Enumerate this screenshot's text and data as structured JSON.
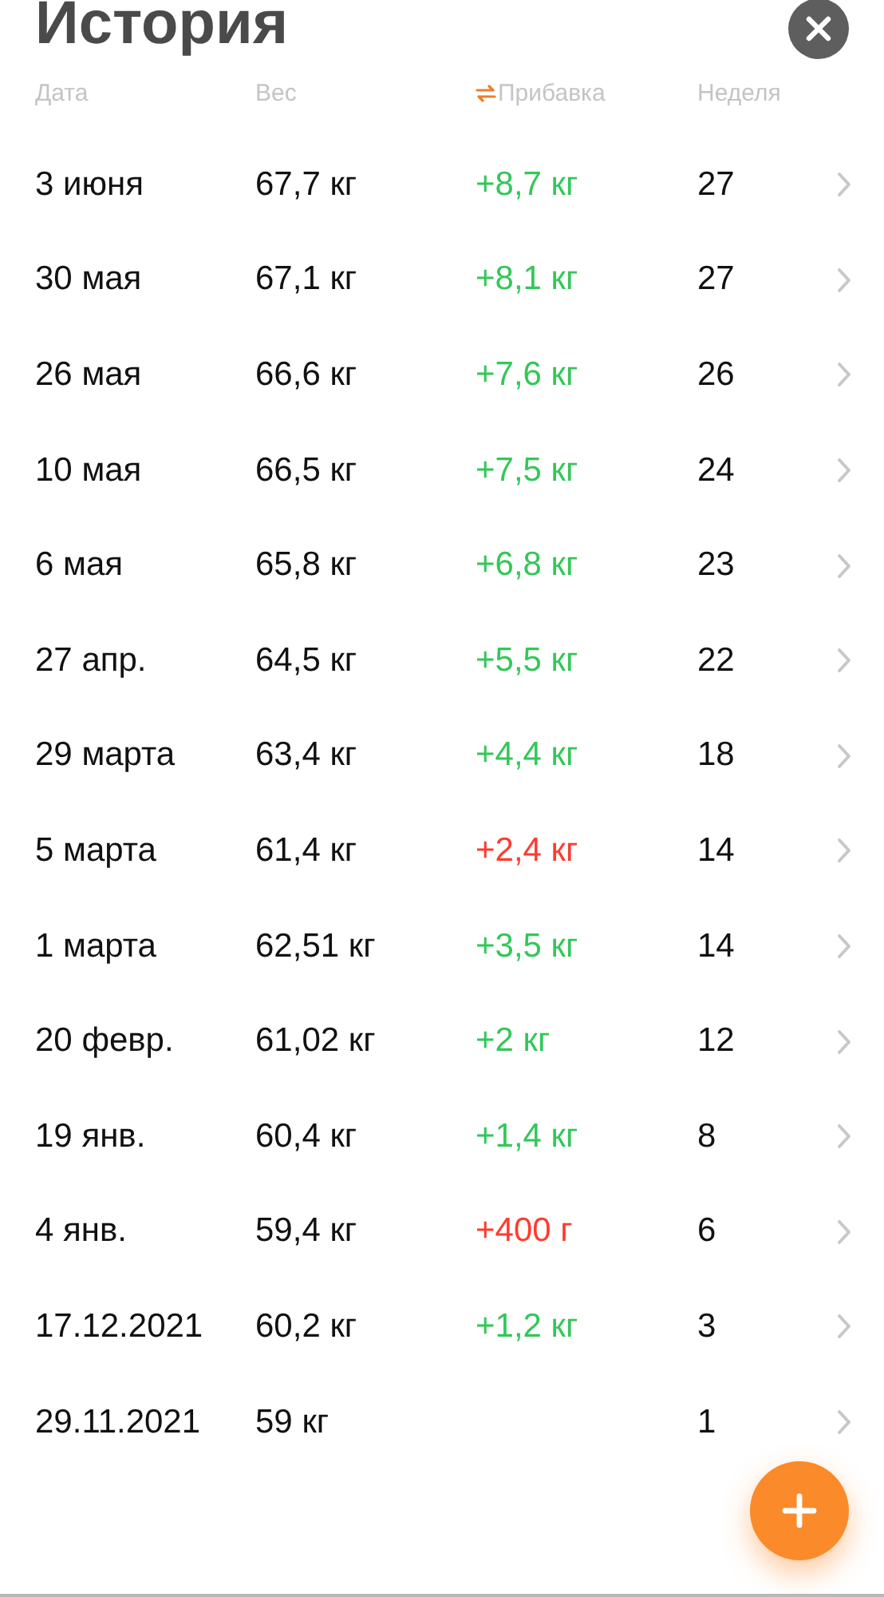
{
  "title": "История",
  "columns": [
    "Дата",
    "Вес",
    "Прибавка",
    "Неделя"
  ],
  "rows": [
    {
      "date": "3 июня",
      "weight": "67,7 кг",
      "gain": "+8,7 кг",
      "color": "#34c759",
      "week": "27"
    },
    {
      "date": "30 мая",
      "weight": "67,1 кг",
      "gain": "+8,1 кг",
      "color": "#34c759",
      "week": "27"
    },
    {
      "date": "26 мая",
      "weight": "66,6 кг",
      "gain": "+7,6 кг",
      "color": "#34c759",
      "week": "26"
    },
    {
      "date": "10 мая",
      "weight": "66,5 кг",
      "gain": "+7,5 кг",
      "color": "#34c759",
      "week": "24"
    },
    {
      "date": "6 мая",
      "weight": "65,8 кг",
      "gain": "+6,8 кг",
      "color": "#34c759",
      "week": "23"
    },
    {
      "date": "27 апр.",
      "weight": "64,5 кг",
      "gain": "+5,5 кг",
      "color": "#34c759",
      "week": "22"
    },
    {
      "date": "29 марта",
      "weight": "63,4 кг",
      "gain": "+4,4 кг",
      "color": "#34c759",
      "week": "18"
    },
    {
      "date": "5 марта",
      "weight": "61,4 кг",
      "gain": "+2,4 кг",
      "color": "#ff3b30",
      "week": "14"
    },
    {
      "date": "1 марта",
      "weight": "62,51 кг",
      "gain": "+3,5 кг",
      "color": "#34c759",
      "week": "14"
    },
    {
      "date": "20 февр.",
      "weight": "61,02 кг",
      "gain": "+2 кг",
      "color": "#34c759",
      "week": "12"
    },
    {
      "date": "19 янв.",
      "weight": "60,4 кг",
      "gain": "+1,4 кг",
      "color": "#34c759",
      "week": "8"
    },
    {
      "date": "4 янв.",
      "weight": "59,4 кг",
      "gain": "+400 г",
      "color": "#ff3b30",
      "week": "6"
    },
    {
      "date": "17.12.2021",
      "weight": "60,2 кг",
      "gain": "+1,2 кг",
      "color": "#34c759",
      "week": "3"
    },
    {
      "date": "29.11.2021",
      "weight": "59 кг",
      "week": "1"
    }
  ]
}
